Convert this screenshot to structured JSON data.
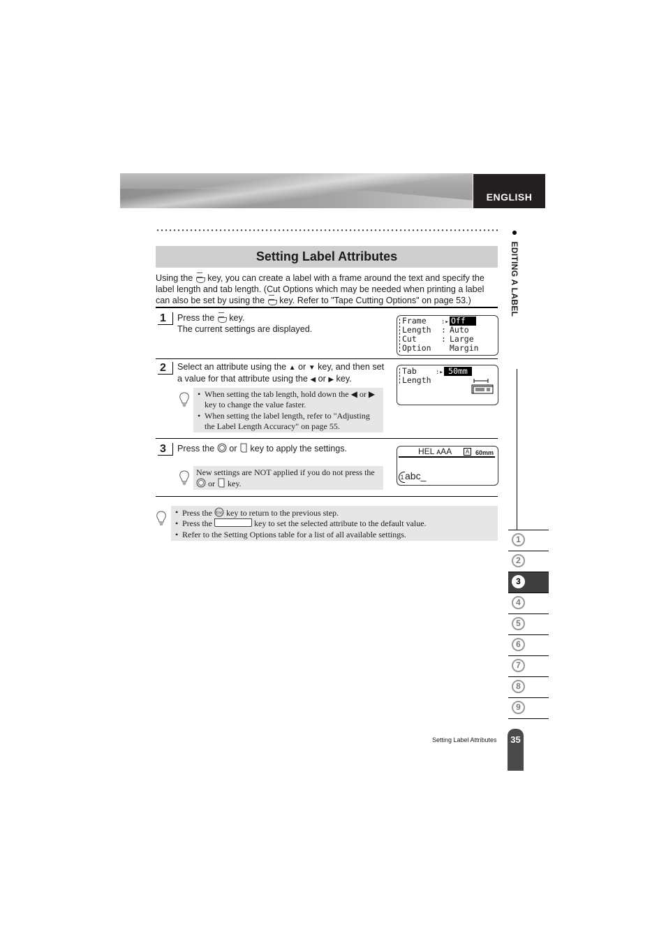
{
  "header": {
    "language_tab": "ENGLISH"
  },
  "side": {
    "section_label": "EDITING A LABEL",
    "chapter_tabs": [
      "1",
      "2",
      "3",
      "4",
      "5",
      "6",
      "7",
      "8",
      "9"
    ],
    "active_chapter": "3"
  },
  "title": "Setting Label Attributes",
  "intro": {
    "part1": "Using the ",
    "part2": " key, you can create a label with a frame around the text and specify the label length and tab length. (Cut Options which may be needed when printing a label can also be set by using the ",
    "part3": " key. Refer to \"Tape Cutting Options\" on page 53.)"
  },
  "steps": [
    {
      "number": "1",
      "line1a": "Press the ",
      "line1b": " key.",
      "line2": "The current settings are displayed.",
      "lcd": [
        {
          "label": "Frame",
          "sep": ":▸",
          "value": "Off",
          "highlight": true
        },
        {
          "label": "Length",
          "sep": ":",
          "value": "Auto",
          "highlight": false
        },
        {
          "label": "Cut",
          "sep": ":",
          "value": "Large",
          "highlight": false
        },
        {
          "label": "Option",
          "sep": "",
          "value": "Margin",
          "highlight": false
        }
      ]
    },
    {
      "number": "2",
      "line1a": "Select an attribute using the ",
      "up": "▲",
      "or1": " or ",
      "down": "▼",
      "line1b": " key, and then set",
      "line2a": "a value for that attribute using the ",
      "left": "◀",
      "or2": " or ",
      "right": "▶",
      "line2b": " key.",
      "notes": [
        "When setting the tab length, hold down the ◀ or ▶ key to change the value faster.",
        "When setting the label length, refer to \"Adjusting the Label Length Accuracy\" on page 55."
      ],
      "lcd": {
        "row1_label": "Tab",
        "row1_sep": ":▸",
        "row1_value": "50mm",
        "row2_label": "Length"
      }
    },
    {
      "number": "3",
      "line1a": "Press the ",
      "ok_key": "OK",
      "or": " or ",
      "line1b": " key to apply the settings.",
      "note_a": "New settings are NOT applied if you do not press the",
      "note_b": " or ",
      "note_c": " key.",
      "lcd": {
        "top": "HEL ᴀAA",
        "length": "60mm",
        "line": "1",
        "text": "abc_"
      }
    }
  ],
  "tips": [
    {
      "a": "Press the ",
      "key": "Esc",
      "b": " key to return to the previous step."
    },
    {
      "a": "Press the ",
      "key": "",
      "b": " key to set the selected attribute to the default value."
    },
    {
      "a": "Refer to the Setting Options table for a list of all available settings.",
      "key": null,
      "b": ""
    }
  ],
  "footer": {
    "section": "Setting Label Attributes",
    "page": "35"
  }
}
